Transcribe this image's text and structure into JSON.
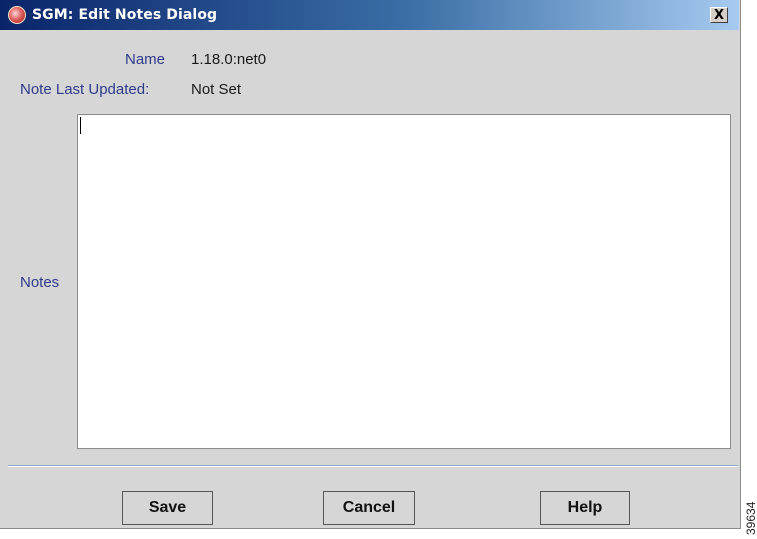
{
  "window": {
    "title": "SGM: Edit Notes Dialog",
    "icon": "sgm-app-icon",
    "close_label": "X"
  },
  "fields": {
    "name_label": "Name",
    "name_value": "1.18.0:net0",
    "updated_label": "Note Last Updated:",
    "updated_value": "Not Set",
    "notes_label": "Notes",
    "notes_value": ""
  },
  "buttons": {
    "save": "Save",
    "cancel": "Cancel",
    "help": "Help"
  },
  "figure_code": "39634",
  "colors": {
    "titlebar_start": "#0a246a",
    "titlebar_end": "#a6caf0",
    "label_blue": "#2e3a8c",
    "dialog_bg": "#d6d6d6"
  }
}
